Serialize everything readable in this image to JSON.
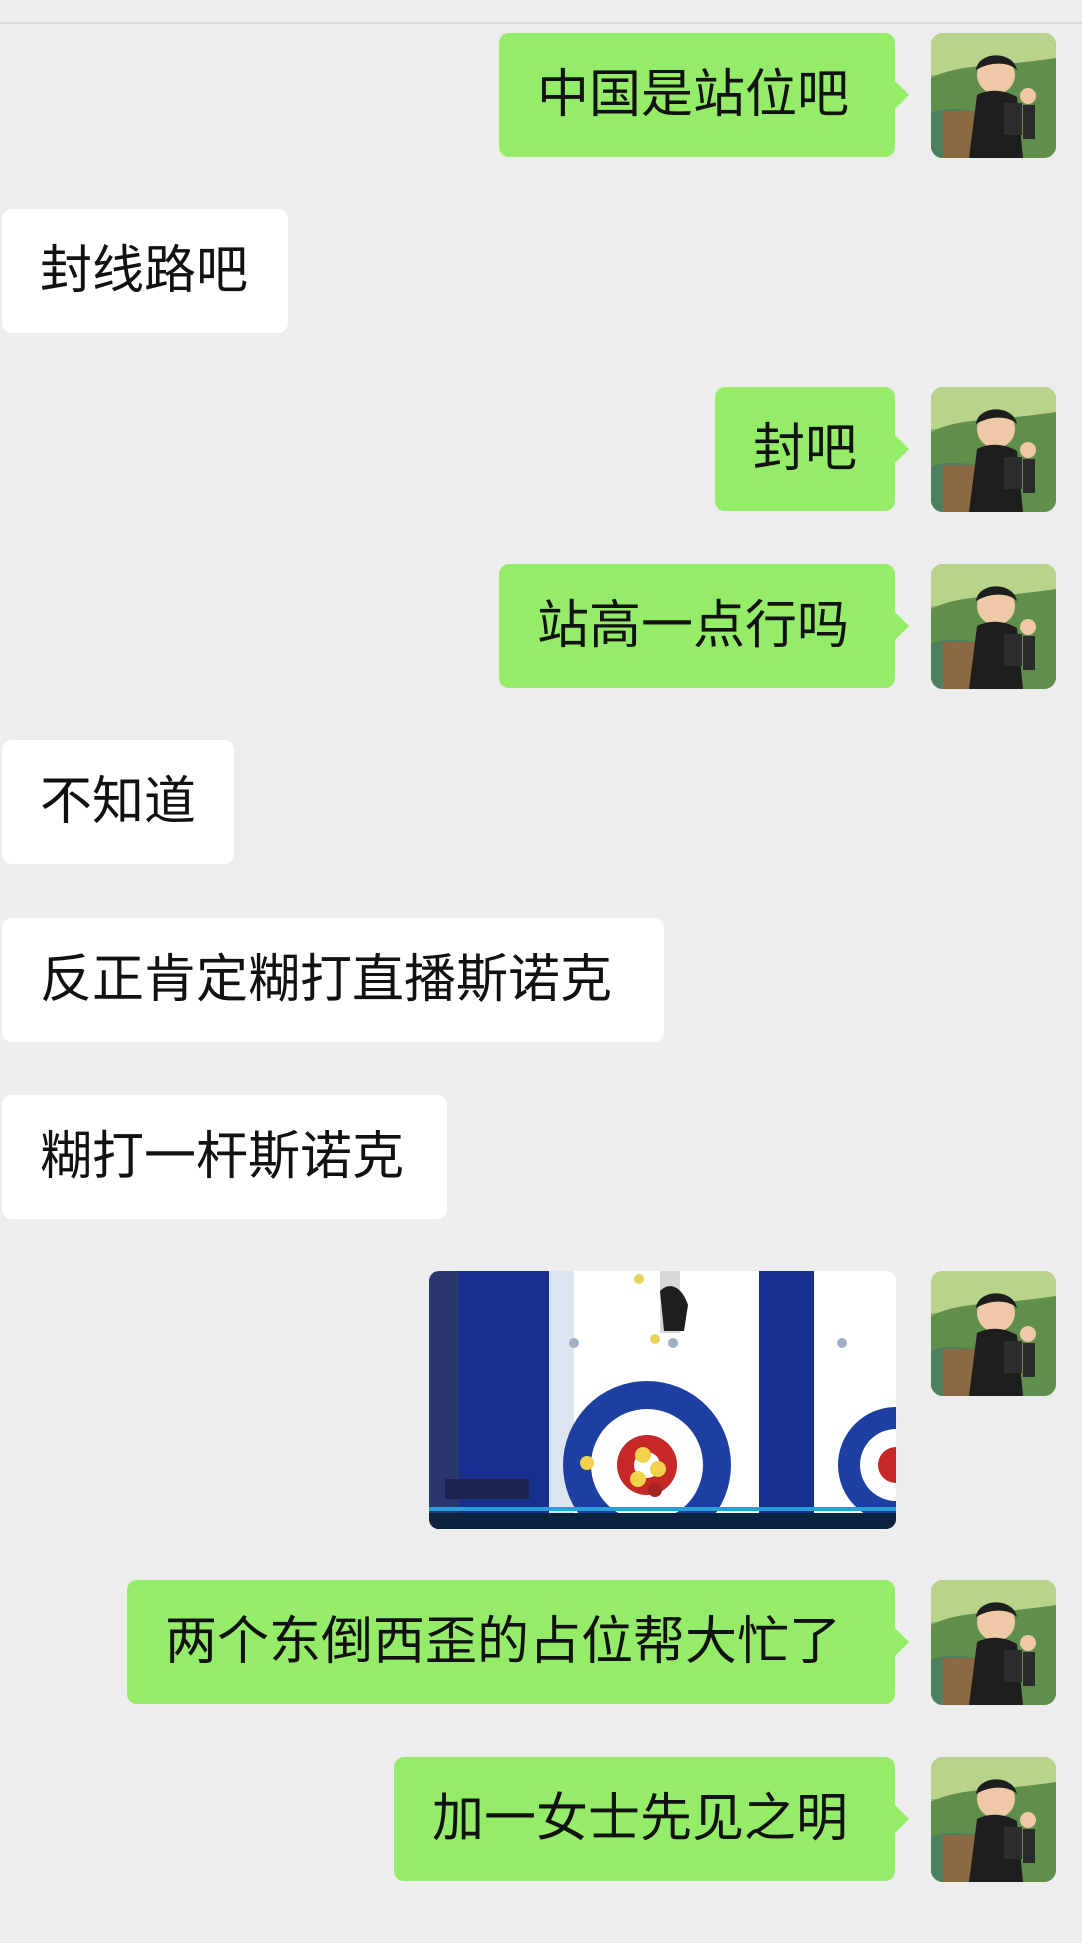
{
  "chat": {
    "messages": [
      {
        "side": "out",
        "text": "中国是站位吧"
      },
      {
        "side": "in",
        "text": "封线路吧"
      },
      {
        "side": "out",
        "text": "封吧"
      },
      {
        "side": "out",
        "text": "站高一点行吗"
      },
      {
        "side": "in",
        "text": "不知道"
      },
      {
        "side": "in",
        "text": "反正肯定糊打直播斯诺克"
      },
      {
        "side": "in",
        "text": "糊打一杆斯诺克"
      },
      {
        "side": "out",
        "type": "image",
        "image_icon": "curling-sheet-image"
      },
      {
        "side": "out",
        "text": "两个东倒西歪的占位帮大忙了"
      },
      {
        "side": "out",
        "text": "加一女士先见之明"
      }
    ]
  },
  "colors": {
    "background": "#ededed",
    "outgoing_bubble": "#95ec69",
    "incoming_bubble": "#ffffff",
    "text": "#111111"
  }
}
